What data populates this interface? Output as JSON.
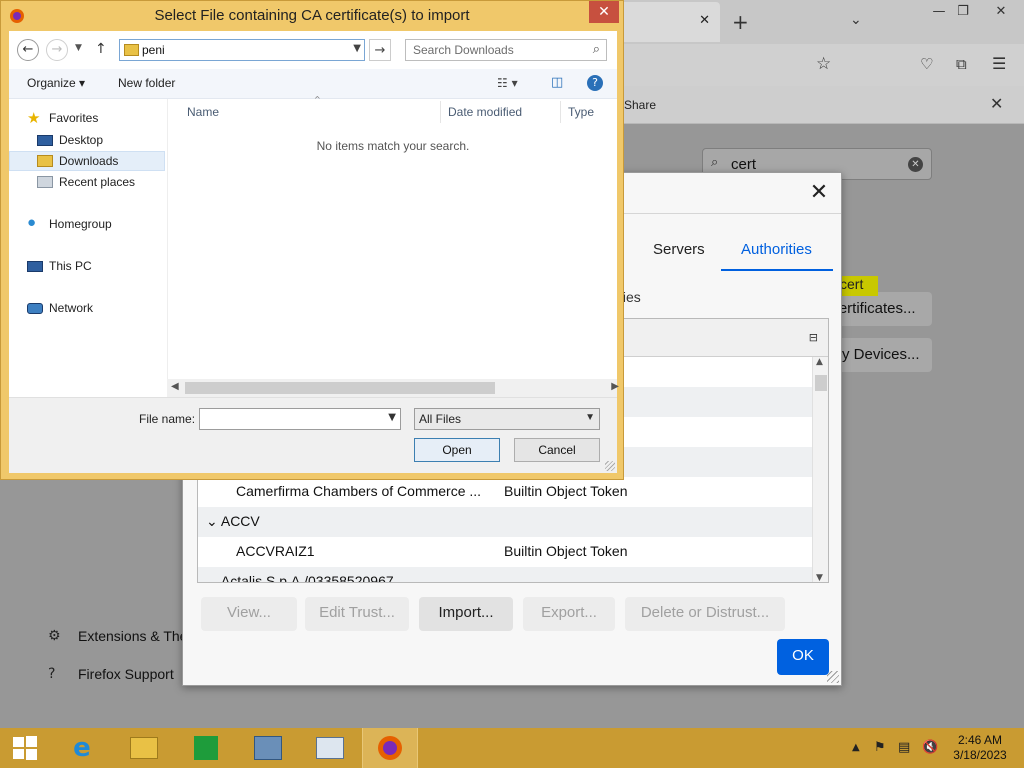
{
  "browser": {
    "tab_close": "✕",
    "new_tab": "+",
    "share_label": "Share",
    "search_value": "cert",
    "highlight_text": "cert",
    "certificates_button": "Certificates...",
    "devices_button": "y Devices...",
    "sidebar_links": [
      "Extensions & Themes",
      "Firefox Support"
    ]
  },
  "cert_manager": {
    "tabs": [
      "Servers",
      "Authorities"
    ],
    "active_tab": "Authorities",
    "description": "ties",
    "rows": [
      {
        "kind": "cert",
        "name": "",
        "token": "ken"
      },
      {
        "kind": "cert",
        "name": "",
        "token": "ken"
      },
      {
        "kind": "cert",
        "name": "Camerfirma Chambers of Commerce ...",
        "token": "Builtin Object Token"
      },
      {
        "kind": "group",
        "name": "ACCV"
      },
      {
        "kind": "cert",
        "name": "ACCVRAIZ1",
        "token": "Builtin Object Token"
      },
      {
        "kind": "group",
        "name": "Actalis S.p.A./03358520967"
      }
    ],
    "buttons": {
      "view": "View...",
      "edit_trust": "Edit Trust...",
      "import": "Import...",
      "export": "Export...",
      "delete": "Delete or Distrust...",
      "ok": "OK"
    }
  },
  "file_dialog": {
    "title": "Select File containing CA certificate(s) to import",
    "address_value": "peni",
    "search_placeholder": "Search Downloads",
    "organize": "Organize ▾",
    "new_folder": "New folder",
    "nav": {
      "favorites": "Favorites",
      "desktop": "Desktop",
      "downloads": "Downloads",
      "recent": "Recent places",
      "homegroup": "Homegroup",
      "thispc": "This PC",
      "network": "Network"
    },
    "columns": [
      "Name",
      "Date modified",
      "Type"
    ],
    "empty_message": "No items match your search.",
    "file_name_label": "File name:",
    "file_name_value": "",
    "file_type": "All Files",
    "open_button": "Open",
    "cancel_button": "Cancel"
  },
  "taskbar": {
    "time": "2:46 AM",
    "date": "3/18/2023"
  },
  "colors": {
    "accent": "#0060df",
    "dialog_frame": "#f0c86a",
    "taskbar": "#c99b32"
  }
}
